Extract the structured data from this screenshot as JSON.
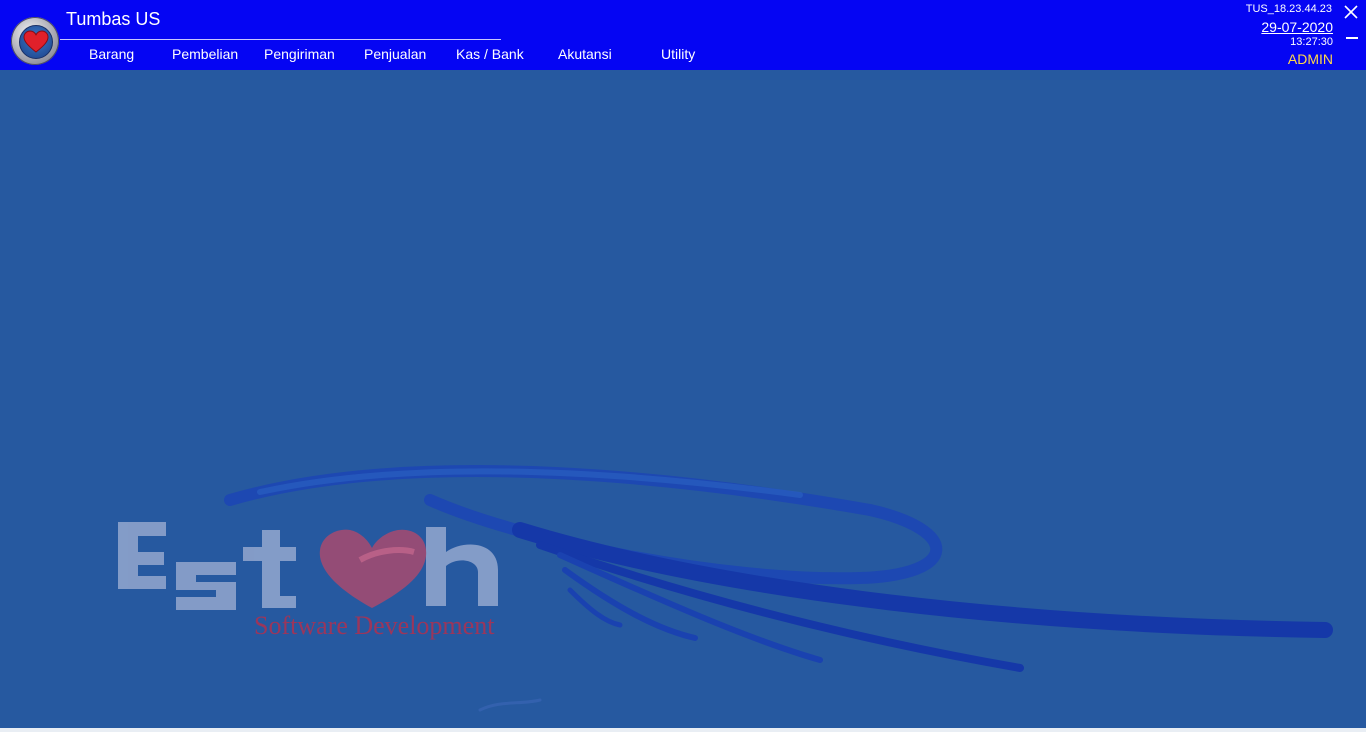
{
  "app": {
    "title": "Tumbas US"
  },
  "menu": {
    "items": [
      {
        "label": "Barang"
      },
      {
        "label": "Pembelian"
      },
      {
        "label": "Pengiriman"
      },
      {
        "label": "Penjualan"
      },
      {
        "label": "Kas / Bank"
      },
      {
        "label": "Akutansi"
      },
      {
        "label": "Utility"
      }
    ]
  },
  "status": {
    "code": "TUS_18.23.44.23",
    "date": "29-07-2020",
    "time": "13:27:30",
    "user": "ADMIN"
  },
  "watermark": {
    "brand": "Esteh",
    "tagline": "Software Development"
  },
  "colors": {
    "topbar": "#0505f3",
    "desktop": "#2659a0",
    "user_text": "#ffd84a",
    "tagline": "#b03050"
  },
  "icons": {
    "app": "heart-icon",
    "close": "close-icon",
    "minimize": "minimize-icon"
  }
}
